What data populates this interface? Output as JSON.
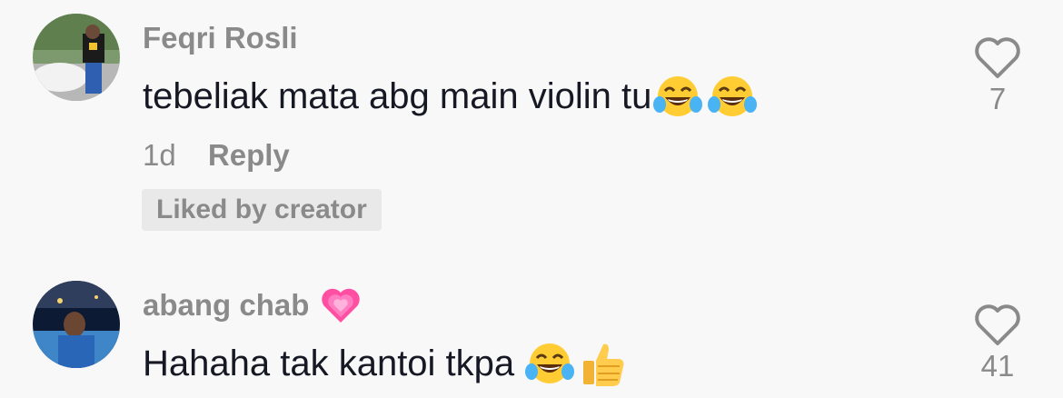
{
  "comments": [
    {
      "username": "Feqri Rosli",
      "text": "tebeliak mata abg main violin tu",
      "emojis": [
        "face-with-tears-of-joy",
        "face-with-tears-of-joy"
      ],
      "time": "1d",
      "reply_label": "Reply",
      "liked_by_creator": "Liked by creator",
      "like_count": "7",
      "like_icon": "heart-outline-icon"
    },
    {
      "username": "abang chab",
      "username_badge": "growing-heart",
      "text": "Hahaha tak kantoi tkpa",
      "emojis": [
        "face-with-tears-of-joy",
        "thumbs-up"
      ],
      "like_count": "41",
      "like_icon": "heart-outline-icon"
    }
  ],
  "colors": {
    "background": "#f8f8f8",
    "primary_text": "#161823",
    "secondary_text": "#8a8a8a",
    "pill_bg": "#e9e9e9"
  }
}
